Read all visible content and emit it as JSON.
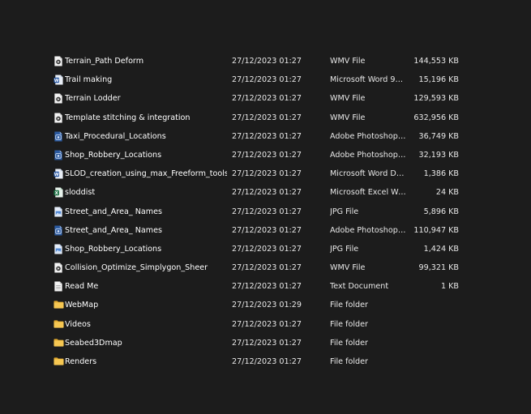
{
  "files": [
    {
      "name": "Terrain_Path Deform",
      "date": "27/12/2023 01:27",
      "type": "WMV File",
      "size": "144,553 KB",
      "icon": "video-file-icon"
    },
    {
      "name": "Trail making",
      "date": "27/12/2023 01:27",
      "type": "Microsoft Word 97 ...",
      "size": "15,196 KB",
      "icon": "word-file-icon"
    },
    {
      "name": "Terrain Lodder",
      "date": "27/12/2023 01:27",
      "type": "WMV File",
      "size": "129,593 KB",
      "icon": "video-file-icon"
    },
    {
      "name": "Template stitching & integration",
      "date": "27/12/2023 01:27",
      "type": "WMV File",
      "size": "632,956 KB",
      "icon": "video-file-icon"
    },
    {
      "name": "Taxi_Procedural_Locations",
      "date": "27/12/2023 01:27",
      "type": "Adobe Photoshop I...",
      "size": "36,749 KB",
      "icon": "photoshop-file-icon"
    },
    {
      "name": "Shop_Robbery_Locations",
      "date": "27/12/2023 01:27",
      "type": "Adobe Photoshop I...",
      "size": "32,193 KB",
      "icon": "photoshop-file-icon"
    },
    {
      "name": "SLOD_creation_using_max_Freeform_tools",
      "date": "27/12/2023 01:27",
      "type": "Microsoft Word Do...",
      "size": "1,386 KB",
      "icon": "word-file-icon"
    },
    {
      "name": "sloddist",
      "date": "27/12/2023 01:27",
      "type": "Microsoft Excel Wo...",
      "size": "24 KB",
      "icon": "excel-file-icon"
    },
    {
      "name": "Street_and_Area_ Names",
      "date": "27/12/2023 01:27",
      "type": "JPG File",
      "size": "5,896 KB",
      "icon": "image-file-icon"
    },
    {
      "name": "Street_and_Area_ Names",
      "date": "27/12/2023 01:27",
      "type": "Adobe Photoshop I...",
      "size": "110,947 KB",
      "icon": "photoshop-file-icon"
    },
    {
      "name": "Shop_Robbery_Locations",
      "date": "27/12/2023 01:27",
      "type": "JPG File",
      "size": "1,424 KB",
      "icon": "image-file-icon"
    },
    {
      "name": "Collision_Optimize_Simplygon_Sheer",
      "date": "27/12/2023 01:27",
      "type": "WMV File",
      "size": "99,321 KB",
      "icon": "video-file-icon"
    },
    {
      "name": "Read Me",
      "date": "27/12/2023 01:27",
      "type": "Text Document",
      "size": "1 KB",
      "icon": "text-file-icon"
    },
    {
      "name": "WebMap",
      "date": "27/12/2023 01:29",
      "type": "File folder",
      "size": "",
      "icon": "folder-icon"
    },
    {
      "name": "Videos",
      "date": "27/12/2023 01:27",
      "type": "File folder",
      "size": "",
      "icon": "folder-icon"
    },
    {
      "name": "Seabed3Dmap",
      "date": "27/12/2023 01:27",
      "type": "File folder",
      "size": "",
      "icon": "folder-icon"
    },
    {
      "name": "Renders",
      "date": "27/12/2023 01:27",
      "type": "File folder",
      "size": "",
      "icon": "folder-icon"
    }
  ]
}
